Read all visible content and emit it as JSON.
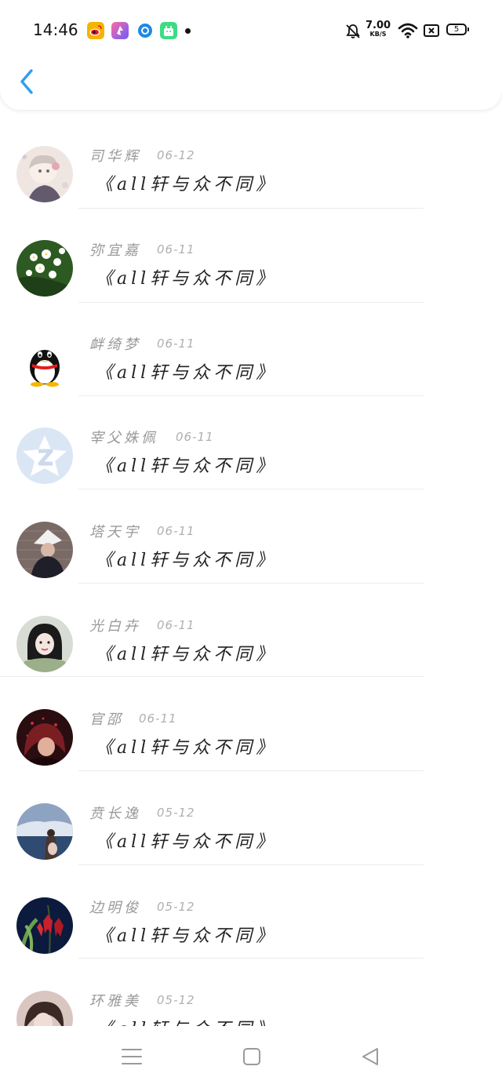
{
  "status_bar": {
    "time": "14:46",
    "net_speed": "7.00",
    "net_unit": "KB/S",
    "battery": "5",
    "app_icons": [
      "weibo-icon",
      "shortcut-icon",
      "browser-icon",
      "android-store-icon"
    ],
    "right_icons": [
      "bell-off-icon",
      "wifi-icon",
      "sim-off-icon",
      "battery-icon"
    ]
  },
  "nav": {
    "back_icon": "chevron-left-icon",
    "accent_color": "#2f9ef0"
  },
  "items": [
    {
      "name": "司华辉",
      "date": "06-12",
      "title": "《all轩与众不同》",
      "avatar": "girl-illustration"
    },
    {
      "name": "弥宜嘉",
      "date": "06-11",
      "title": "《all轩与众不同》",
      "avatar": "white-flowers"
    },
    {
      "name": "衅绮梦",
      "date": "06-11",
      "title": "《all轩与众不同》",
      "avatar": "qq-penguin"
    },
    {
      "name": "宰父姝佩",
      "date": "06-11",
      "title": "《all轩与众不同》",
      "avatar": "default-z-star"
    },
    {
      "name": "塔天宇",
      "date": "06-11",
      "title": "《all轩与众不同》",
      "avatar": "person-hat"
    },
    {
      "name": "光白卉",
      "date": "06-11",
      "title": "《all轩与众不同》",
      "avatar": "girl-photo"
    },
    {
      "name": "官邵",
      "date": "06-11",
      "title": "《all轩与众不同》",
      "avatar": "red-hair-girl"
    },
    {
      "name": "贲长逸",
      "date": "05-12",
      "title": "《all轩与众不同》",
      "avatar": "sea-person"
    },
    {
      "name": "边明俊",
      "date": "05-12",
      "title": "《all轩与众不同》",
      "avatar": "red-orchid"
    },
    {
      "name": "环雅美",
      "date": "05-12",
      "title": "《all轩与众不同》",
      "avatar": "woman-portrait"
    }
  ],
  "bottom_nav": {
    "icons": [
      "menu-icon",
      "home-square-icon",
      "back-triangle-icon"
    ]
  }
}
